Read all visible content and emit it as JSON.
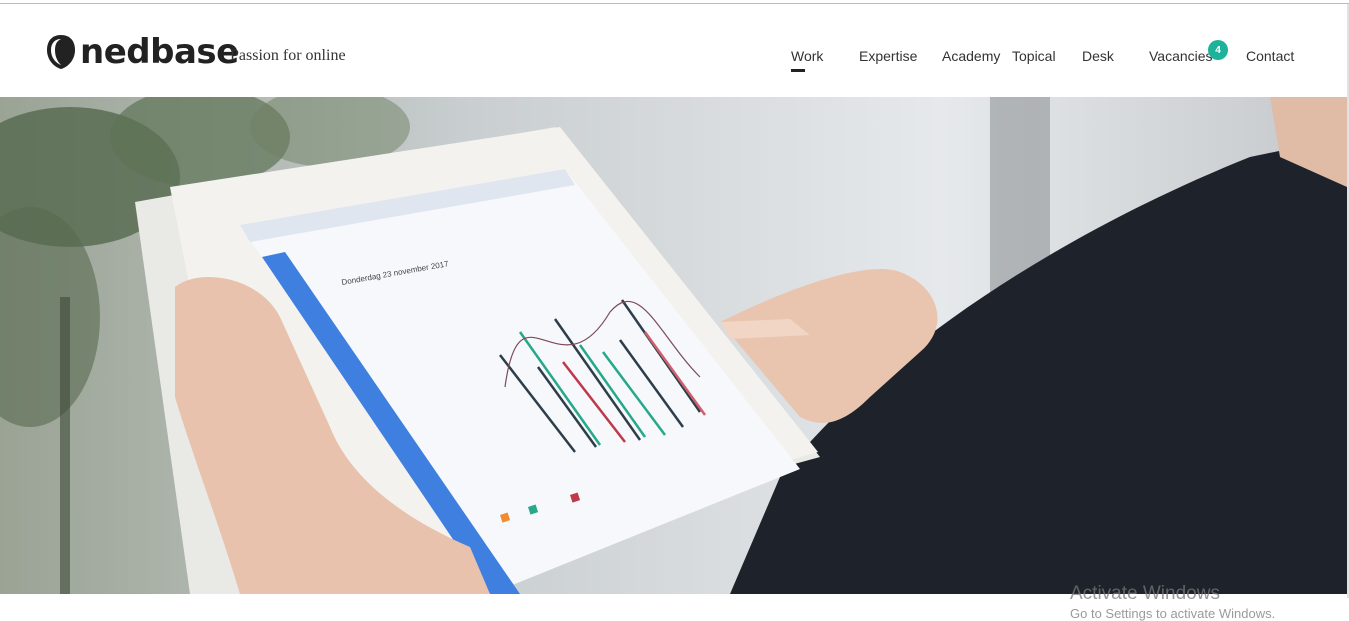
{
  "brand": {
    "name": "nedbase",
    "tagline": "Passion for online"
  },
  "nav": {
    "items": [
      {
        "label": "Work",
        "active": true
      },
      {
        "label": "Expertise",
        "active": false
      },
      {
        "label": "Academy",
        "active": false
      },
      {
        "label": "Topical",
        "active": false
      },
      {
        "label": "Desk",
        "active": false
      },
      {
        "label": "Vacancies",
        "active": false,
        "badge": "4"
      },
      {
        "label": "Contact",
        "active": false
      }
    ]
  },
  "hero": {
    "tablet_date": "Donderdag 23 november 2017"
  },
  "watermark": {
    "title": "Activate Windows",
    "subtitle": "Go to Settings to activate Windows."
  },
  "colors": {
    "accent": "#1db39a",
    "text": "#333333",
    "active_underline": "#222222"
  }
}
